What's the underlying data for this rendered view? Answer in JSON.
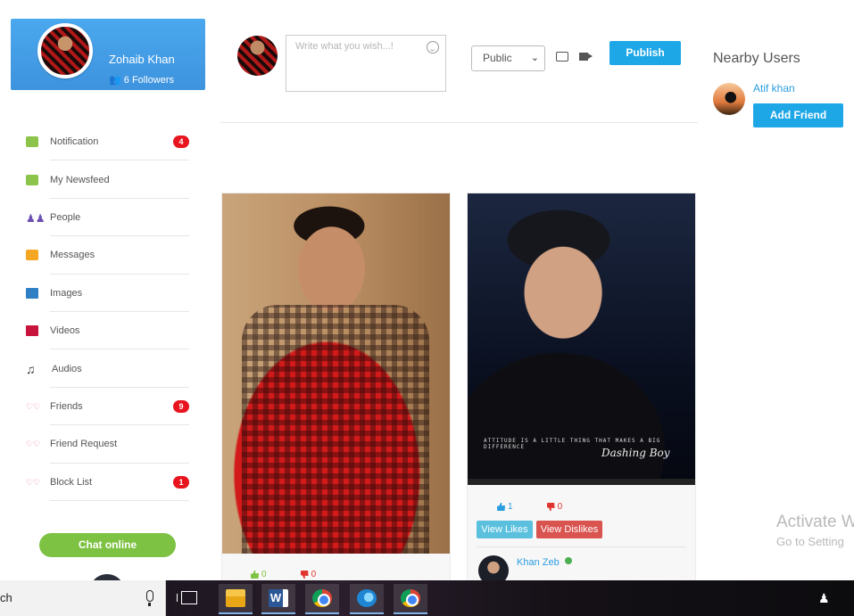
{
  "profile": {
    "name": "Zohaib Khan",
    "followers": "6 Followers"
  },
  "menu": [
    {
      "label": "Notification",
      "icon": "notification-icon",
      "badge": "4"
    },
    {
      "label": "My Newsfeed",
      "icon": "newsfeed-icon",
      "badge": ""
    },
    {
      "label": "People",
      "icon": "people-icon",
      "badge": ""
    },
    {
      "label": "Messages",
      "icon": "messages-icon",
      "badge": ""
    },
    {
      "label": "Images",
      "icon": "images-icon",
      "badge": ""
    },
    {
      "label": "Videos",
      "icon": "videos-icon",
      "badge": ""
    },
    {
      "label": "Audios",
      "icon": "audio-icon",
      "badge": ""
    },
    {
      "label": "Friends",
      "icon": "friends-icon",
      "badge": "9"
    },
    {
      "label": "Friend Request",
      "icon": "friend-request-icon",
      "badge": ""
    },
    {
      "label": "Block List",
      "icon": "block-list-icon",
      "badge": "1"
    }
  ],
  "chat_button": "Chat online",
  "composer": {
    "placeholder": "Write what you wish...!",
    "privacy": "Public",
    "publish_label": "Publish"
  },
  "nearby": {
    "title": "Nearby Users",
    "users": [
      {
        "name": "Atif khan",
        "button": "Add Friend"
      }
    ]
  },
  "posts": [
    {
      "likes": "0",
      "dislikes": "0"
    },
    {
      "likes": "1",
      "dislikes": "0",
      "view_likes": "View Likes",
      "view_dislikes": "View Dislikes",
      "author": "Khan Zeb",
      "photo_caption": "ATTITUDE IS A LITTLE THING THAT MAKES A BIG DIFFERENCE",
      "photo_script": "Dashing Boy"
    }
  ],
  "watermark": {
    "title": "Activate W",
    "subtitle": "Go to Setting"
  },
  "taskbar": {
    "search_text": "ch"
  },
  "colors": {
    "primary_blue": "#1ea7e7",
    "badge_red": "#e8141e",
    "chat_green": "#7dc242"
  }
}
